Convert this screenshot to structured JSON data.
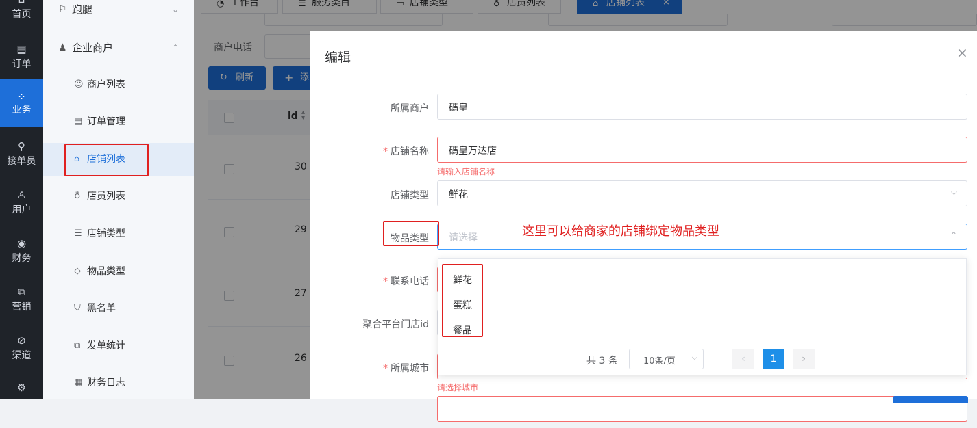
{
  "rail": {
    "items": [
      {
        "label": "首页",
        "icon": "home-icon"
      },
      {
        "label": "订单",
        "icon": "order-icon"
      },
      {
        "label": "业务",
        "icon": "grid-icon"
      },
      {
        "label": "接单员",
        "icon": "bicycle-icon"
      },
      {
        "label": "用户",
        "icon": "user-icon"
      },
      {
        "label": "财务",
        "icon": "finance-icon"
      },
      {
        "label": "营销",
        "icon": "chart-icon"
      },
      {
        "label": "渠道",
        "icon": "channel-icon"
      }
    ],
    "active_index": 2
  },
  "submenu": {
    "group_paotui": "跑腿",
    "group_enterprise": "企业商户",
    "items": [
      "商户列表",
      "订单管理",
      "店铺列表",
      "店员列表",
      "店铺类型",
      "物品类型",
      "黑名单",
      "发单统计",
      "财务日志"
    ],
    "active": "店铺列表"
  },
  "tabs": [
    "工作台",
    "服务类目",
    "店铺类型",
    "店员列表",
    "店铺列表"
  ],
  "tab_close": "×",
  "search": {
    "merchant_phone_label": "商户电话"
  },
  "toolbar": {
    "refresh": "刷新",
    "add": "添"
  },
  "table": {
    "header_id": "id",
    "ids": [
      "30",
      "29",
      "27",
      "26"
    ]
  },
  "dialog": {
    "title": "编辑",
    "close": "×",
    "fields": {
      "merchant_label": "所属商户",
      "merchant_value": "碼皇",
      "store_name_label": "店铺名称",
      "store_name_value": "碼皇万达店",
      "store_name_error": "请输入店铺名称",
      "store_type_label": "店铺类型",
      "store_type_value": "鲜花",
      "goods_type_label": "物品类型",
      "goods_type_placeholder": "请选择",
      "phone_label": "联系电话",
      "platform_label": "聚合平台门店id",
      "city_label": "所属城市",
      "city_error": "请选择城市"
    }
  },
  "dropdown": {
    "options": [
      "鲜花",
      "蛋糕",
      "餐品"
    ],
    "total": "共 3 条",
    "page_size": "10条/页",
    "current_page": "1"
  },
  "annotation": "这里可以给商家的店铺绑定物品类型",
  "colors": {
    "primary": "#1e6fd9",
    "error": "#f56c6c",
    "annotation": "#e02020",
    "rail_bg": "#1f2329"
  }
}
